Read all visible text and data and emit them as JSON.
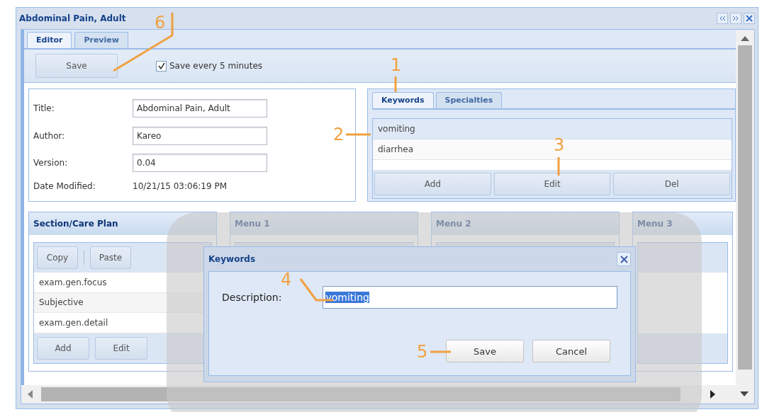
{
  "window": {
    "title": "Abdominal Pain, Adult"
  },
  "tabs": [
    {
      "label": "Editor",
      "selected": true
    },
    {
      "label": "Preview",
      "selected": false
    }
  ],
  "toolbar": {
    "save_button": "Save",
    "autosave": {
      "label": "Save every 5 minutes",
      "checked": true
    }
  },
  "form": {
    "fields": [
      {
        "label": "Title:",
        "value": "Abdominal Pain, Adult"
      },
      {
        "label": "Author:",
        "value": "Kareo"
      },
      {
        "label": "Version:",
        "value": "0.04"
      }
    ],
    "date_modified": {
      "label": "Date Modified:",
      "value": "10/21/15 03:06:19 PM"
    }
  },
  "keywords_panel": {
    "tabs": [
      {
        "label": "Keywords",
        "selected": true
      },
      {
        "label": "Specialties",
        "selected": false
      }
    ],
    "items": [
      {
        "text": "vomiting",
        "selected": true
      },
      {
        "text": "diarrhea",
        "selected": false
      }
    ],
    "buttons": [
      "Add",
      "Edit",
      "Del"
    ]
  },
  "section_panel": {
    "title": "Section/Care Plan",
    "toolbar": [
      "Copy",
      "Paste"
    ],
    "rows": [
      "exam.gen.focus",
      "Subjective",
      "exam.gen.detail"
    ],
    "buttons": [
      "Add",
      "Edit"
    ]
  },
  "menu_panels": [
    {
      "title": "Menu 1"
    },
    {
      "title": "Menu 2"
    },
    {
      "title": "Menu 3"
    }
  ],
  "dialog": {
    "title": "Keywords",
    "label": "Description:",
    "value": "vomiting",
    "text_selected": true,
    "buttons": [
      "Save",
      "Cancel"
    ]
  },
  "callouts": [
    "6",
    "1",
    "2",
    "3",
    "4",
    "5"
  ]
}
